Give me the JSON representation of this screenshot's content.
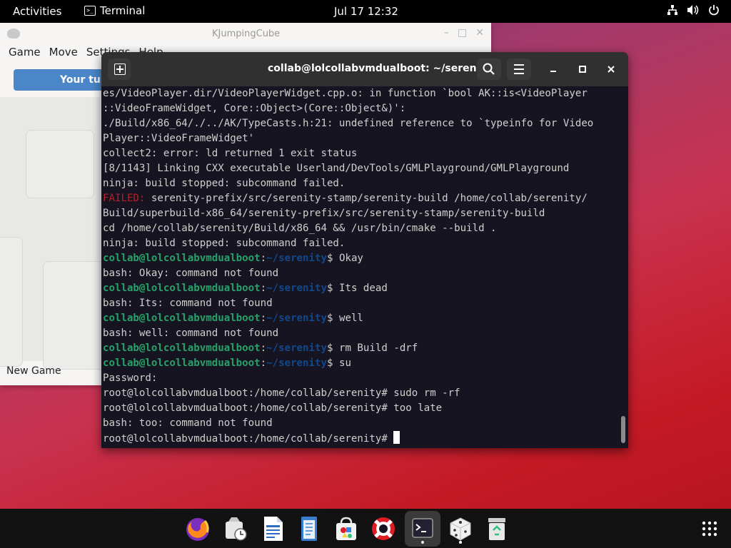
{
  "topbar": {
    "activities": "Activities",
    "app_name": "Terminal",
    "clock": "Jul 17  12:32",
    "tray_icons": [
      "network-icon",
      "volume-icon",
      "power-icon"
    ]
  },
  "kjumpingcube": {
    "title": "KJumpingCube",
    "menu": [
      "Game",
      "Move",
      "Settings",
      "Help"
    ],
    "turn_button": "Your turn",
    "status": "New Game"
  },
  "terminal": {
    "title": "collab@lolcollabvmdualboot: ~/serenity",
    "prompt_user": "collab@lolcollabvmdualboot",
    "prompt_path": "~/serenity",
    "lines": [
      {
        "t": "plain",
        "text": "es/VideoPlayer.dir/VideoPlayerWidget.cpp.o: in function `bool AK::is<VideoPlayer"
      },
      {
        "t": "plain",
        "text": "::VideoFrameWidget, Core::Object>(Core::Object&)':"
      },
      {
        "t": "plain",
        "text": "./Build/x86_64/./../AK/TypeCasts.h:21: undefined reference to `typeinfo for Video"
      },
      {
        "t": "plain",
        "text": "Player::VideoFrameWidget'"
      },
      {
        "t": "plain",
        "text": "collect2: error: ld returned 1 exit status"
      },
      {
        "t": "plain",
        "text": "[8/1143] Linking CXX executable Userland/DevTools/GMLPlayground/GMLPlayground"
      },
      {
        "t": "plain",
        "text": "ninja: build stopped: subcommand failed."
      },
      {
        "t": "failed",
        "label": "FAILED:",
        "text": " serenity-prefix/src/serenity-stamp/serenity-build /home/collab/serenity/"
      },
      {
        "t": "plain",
        "text": "Build/superbuild-x86_64/serenity-prefix/src/serenity-stamp/serenity-build"
      },
      {
        "t": "plain",
        "text": "cd /home/collab/serenity/Build/x86_64 && /usr/bin/cmake --build ."
      },
      {
        "t": "plain",
        "text": "ninja: build stopped: subcommand failed."
      },
      {
        "t": "prompt",
        "cmd": " Okay"
      },
      {
        "t": "plain",
        "text": "bash: Okay: command not found"
      },
      {
        "t": "prompt",
        "cmd": " Its dead"
      },
      {
        "t": "plain",
        "text": "bash: Its: command not found"
      },
      {
        "t": "prompt",
        "cmd": " well"
      },
      {
        "t": "plain",
        "text": "bash: well: command not found"
      },
      {
        "t": "prompt",
        "cmd": " rm Build -drf"
      },
      {
        "t": "prompt",
        "cmd": " su"
      },
      {
        "t": "plain",
        "text": "Password:"
      },
      {
        "t": "plain",
        "text": "root@lolcollabvmdualboot:/home/collab/serenity# sudo rm -rf"
      },
      {
        "t": "plain",
        "text": "root@lolcollabvmdualboot:/home/collab/serenity# too late"
      },
      {
        "t": "plain",
        "text": "bash: too: command not found"
      },
      {
        "t": "cursor",
        "text": "root@lolcollabvmdualboot:/home/collab/serenity# "
      }
    ]
  },
  "dock": {
    "items": [
      "firefox-icon",
      "clocks-icon",
      "writer-icon",
      "text-editor-icon",
      "software-icon",
      "help-icon",
      "terminal-icon",
      "dice-icon",
      "trash-icon",
      "app-grid-icon"
    ]
  },
  "colors": {
    "terminal_bg": "#171421",
    "prompt_user": "#26a269",
    "prompt_path": "#12488b",
    "failed": "#c01c28"
  }
}
